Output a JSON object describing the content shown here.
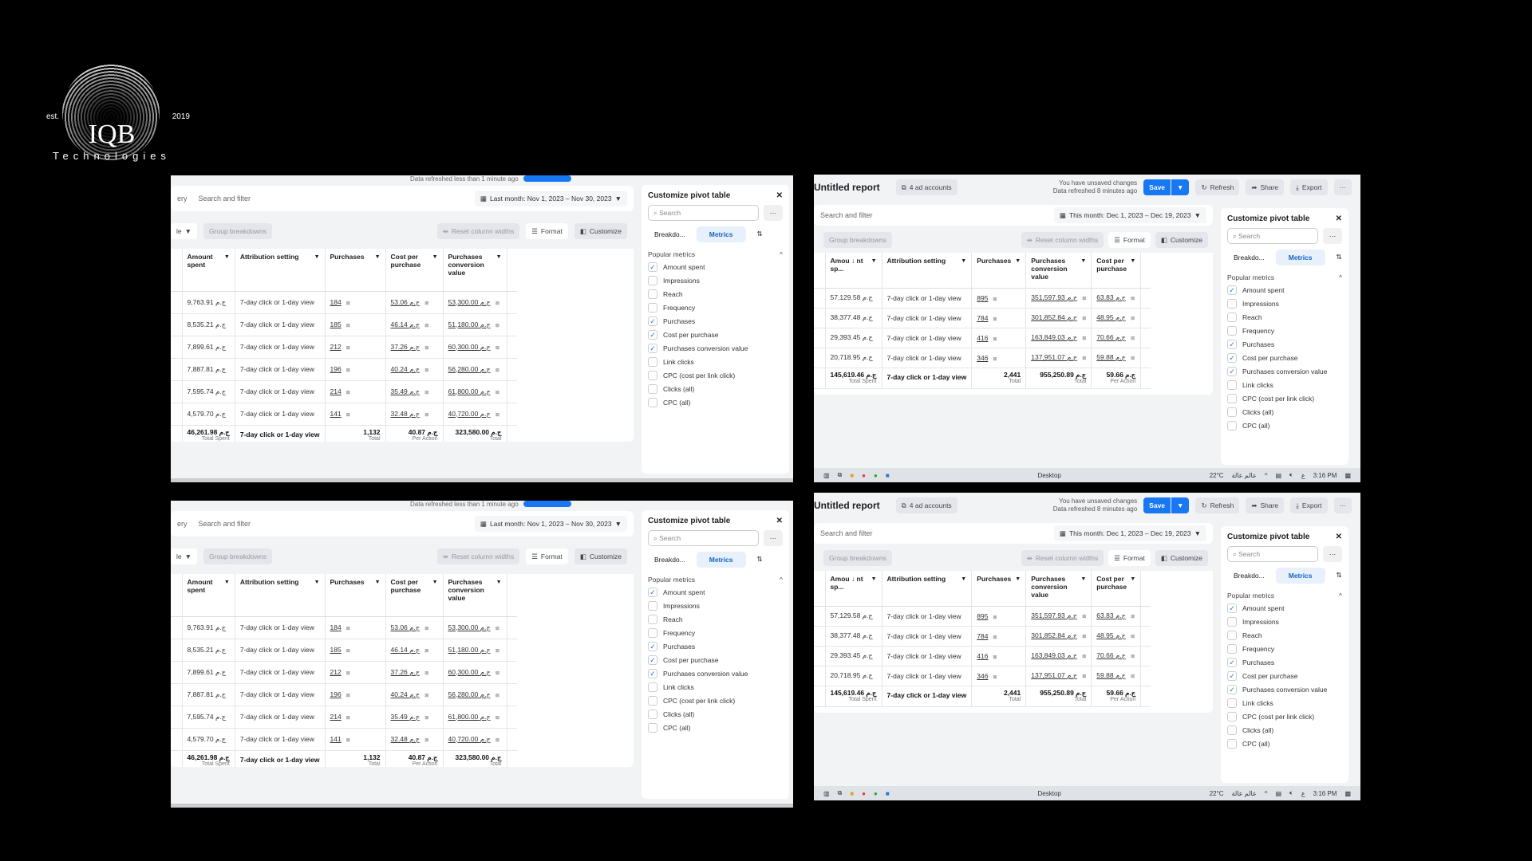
{
  "logo": {
    "est": "est.",
    "year": "2019",
    "name": "IQB",
    "subtitle": "Technologies"
  },
  "left_report": {
    "refresh_text": "Data refreshed less than 1 minute ago",
    "left_fragment": "ery",
    "search_placeholder": "Search and filter",
    "date_range": "Last month: Nov 1, 2023 – Nov 30, 2023",
    "table_select": "le",
    "group_breakdowns": "Group breakdowns",
    "reset_widths": "Reset column widths",
    "format": "Format",
    "customize": "Customize",
    "columns": [
      "Amount spent",
      "Attribution setting",
      "Purchases",
      "Cost per purchase",
      "Purchases conversion value"
    ],
    "rows": [
      [
        "9,763.91 ج.م",
        "7-day click or 1-day view",
        "184",
        "53.06 ج.م",
        "53,300.00 ج.م"
      ],
      [
        "8,535.21 ج.م",
        "7-day click or 1-day view",
        "185",
        "46.14 ج.م",
        "51,180.00 ج.م"
      ],
      [
        "7,899.61 ج.م",
        "7-day click or 1-day view",
        "212",
        "37.26 ج.م",
        "60,300.00 ج.م"
      ],
      [
        "7,887.81 ج.م",
        "7-day click or 1-day view",
        "196",
        "40.24 ج.م",
        "56,280.00 ج.م"
      ],
      [
        "7,595.74 ج.م",
        "7-day click or 1-day view",
        "214",
        "35.49 ج.م",
        "61,800.00 ج.م"
      ],
      [
        "4,579.70 ج.م",
        "7-day click or 1-day view",
        "141",
        "32.48 ج.م",
        "40,720.00 ج.م"
      ]
    ],
    "totals": [
      {
        "value": "46,261.98 ج.م",
        "label": "Total Spent"
      },
      {
        "value": "7-day click or 1-day view",
        "label": ""
      },
      {
        "value": "1,132",
        "label": "Total"
      },
      {
        "value": "40.87 ج.م",
        "label": "Per Action"
      },
      {
        "value": "323,580.00 ج.م",
        "label": "Total"
      }
    ]
  },
  "right_report": {
    "title": "Untitled report",
    "ad_accounts": "4 ad accounts",
    "unsaved": "You have unsaved changes",
    "refresh_text": "Data refreshed 8 minutes ago",
    "save": "Save",
    "refresh": "Refresh",
    "share": "Share",
    "export": "Export",
    "search_placeholder": "Search and filter",
    "date_range": "This month: Dec 1, 2023 – Dec 19, 2023",
    "group_breakdowns": "Group breakdowns",
    "reset_widths": "Reset column widths",
    "format": "Format",
    "customize": "Customize",
    "columns": [
      "Amou ↓ nt sp...",
      "Attribution setting",
      "Purchases",
      "Purchases conversion value",
      "Cost per purchase"
    ],
    "rows": [
      [
        "57,129.58 ج.م",
        "7-day click or 1-day view",
        "895",
        "351,597.93 ج.م",
        "63.83 ج.م"
      ],
      [
        "38,377.48 ج.م",
        "7-day click or 1-day view",
        "784",
        "301,852.84 ج.م",
        "48.95 ج.م"
      ],
      [
        "29,393.45 ج.م",
        "7-day click or 1-day view",
        "416",
        "163,849.03 ج.م",
        "70.66 ج.م"
      ],
      [
        "20,718.95 ج.م",
        "7-day click or 1-day view",
        "346",
        "137,951.07 ج.م",
        "59.88 ج.م"
      ]
    ],
    "totals": [
      {
        "value": "145,619.46 ج.م",
        "label": "Total Spent"
      },
      {
        "value": "7-day click or 1-day view",
        "label": ""
      },
      {
        "value": "2,441",
        "label": "Total"
      },
      {
        "value": "955,250.89 ج.م",
        "label": "Total"
      },
      {
        "value": "59.66 ج.م",
        "label": "Per Action"
      }
    ],
    "taskbar": {
      "desktop": "Desktop",
      "weather": "22°C",
      "weather_text": "عالم عالة",
      "lang": "ع",
      "time": "3:16 PM"
    }
  },
  "customize_panel": {
    "title": "Customize pivot table",
    "search_placeholder": "Search",
    "tab_breakdowns": "Breakdo...",
    "tab_metrics": "Metrics",
    "section": "Popular metrics",
    "metrics": [
      {
        "label": "Amount spent",
        "checked": true
      },
      {
        "label": "Impressions",
        "checked": false
      },
      {
        "label": "Reach",
        "checked": false
      },
      {
        "label": "Frequency",
        "checked": false
      },
      {
        "label": "Purchases",
        "checked": true
      },
      {
        "label": "Cost per purchase",
        "checked": true
      },
      {
        "label": "Purchases conversion value",
        "checked": true
      },
      {
        "label": "Link clicks",
        "checked": false
      },
      {
        "label": "CPC (cost per link click)",
        "checked": false
      },
      {
        "label": "Clicks (all)",
        "checked": false
      },
      {
        "label": "CPC (all)",
        "checked": false
      }
    ]
  },
  "colors": {
    "primary": "#1877f2",
    "background": "#000000"
  }
}
